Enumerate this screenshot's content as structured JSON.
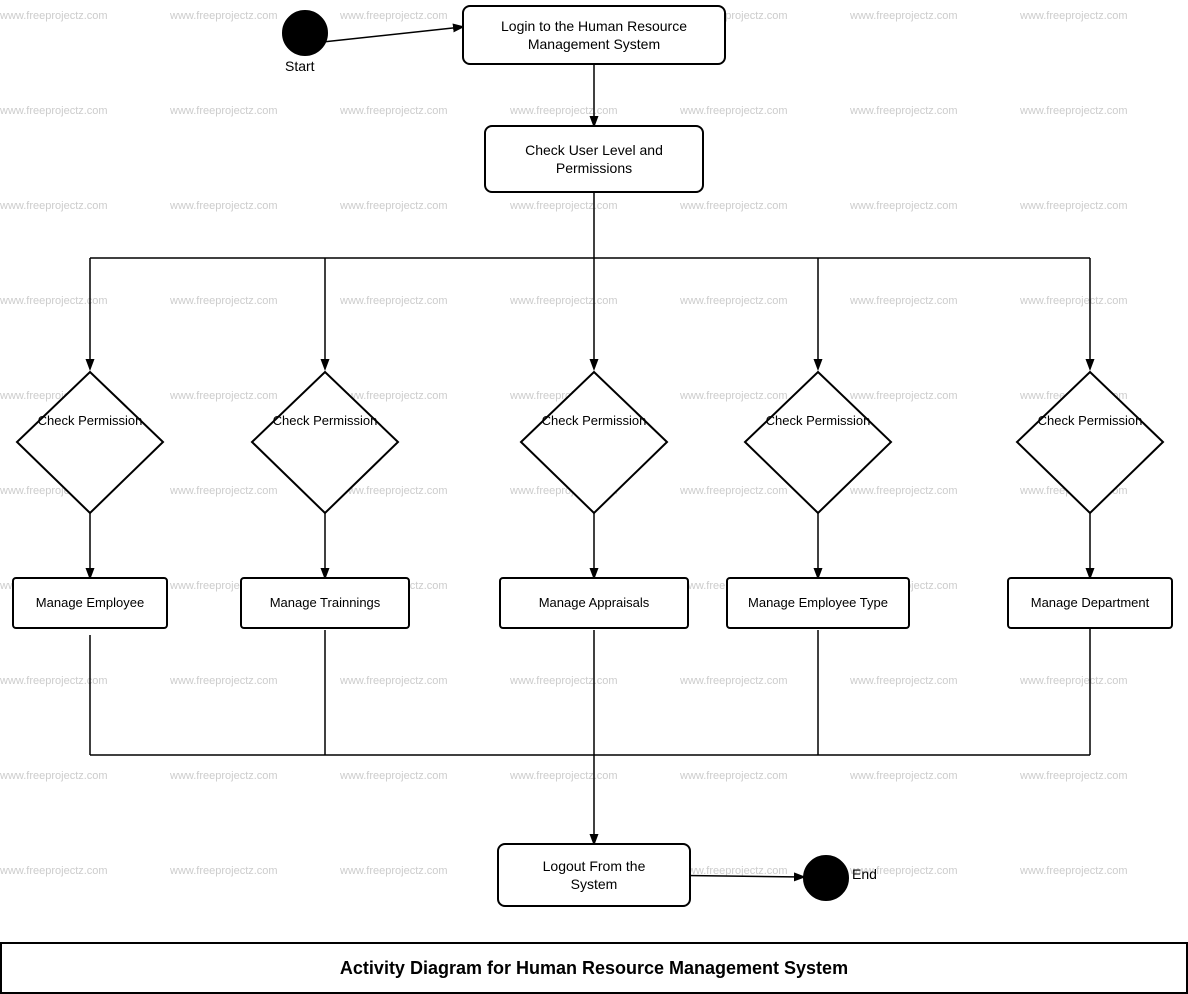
{
  "title": "Activity Diagram for Human Resource Management System",
  "footer": "Activity Diagram for Human Resource Management System",
  "watermark": "www.freeprojectz.com",
  "nodes": {
    "start_label": "Start",
    "end_label": "End",
    "login": "Login to the Human Resource\nManagement System",
    "check_user": "Check User Level and\nPermissions",
    "logout": "Logout From the\nSystem",
    "check_perm1": "Check\nPermission",
    "check_perm2": "Check\nPermission",
    "check_perm3": "Check\nPermission",
    "check_perm4": "Check\nPermission",
    "check_perm5": "Check\nPermission",
    "manage_employee": "Manage Employee",
    "manage_trainings": "Manage Trainnings",
    "manage_appraisals": "Manage Appraisals",
    "manage_employee_type": "Manage Employee Type",
    "manage_department": "Manage Department"
  }
}
